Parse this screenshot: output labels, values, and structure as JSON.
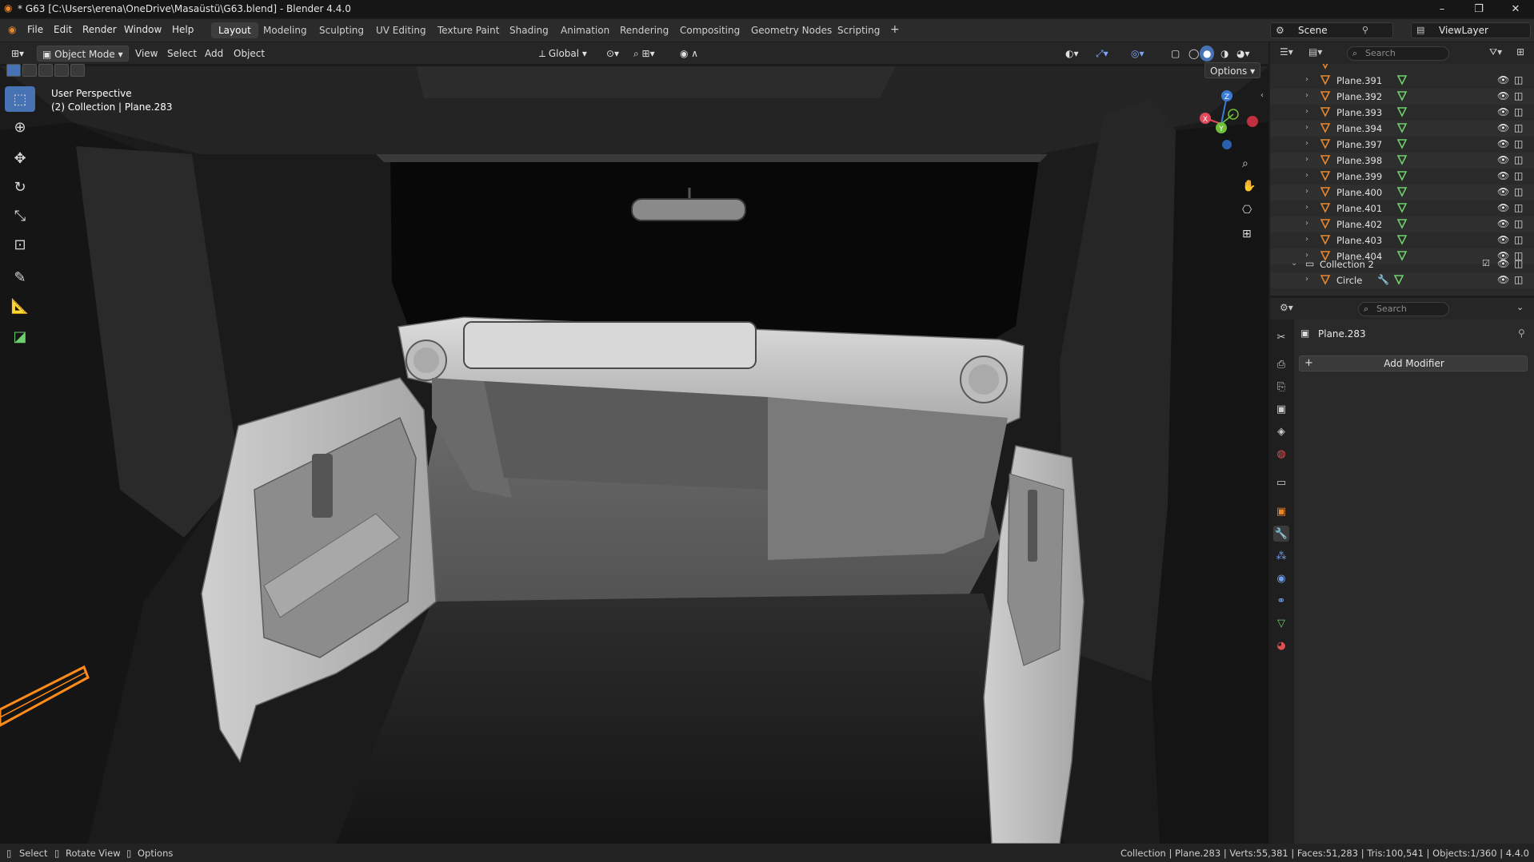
{
  "titlebar": {
    "title": "* G63 [C:\\Users\\erena\\OneDrive\\Masaüstü\\G63.blend] - Blender 4.4.0",
    "minimize": "–",
    "maximize": "❐",
    "close": "✕"
  },
  "menubar": {
    "menus": [
      "File",
      "Edit",
      "Render",
      "Window",
      "Help"
    ],
    "workspaces": [
      "Layout",
      "Modeling",
      "Sculpting",
      "UV Editing",
      "Texture Paint",
      "Shading",
      "Animation",
      "Rendering",
      "Compositing",
      "Geometry Nodes",
      "Scripting"
    ],
    "active_workspace": "Layout",
    "add_tab": "+",
    "scene_label": "Scene",
    "view_layer_label": "ViewLayer"
  },
  "viewport_header": {
    "mode": "Object Mode",
    "menus": [
      "View",
      "Select",
      "Add",
      "Object"
    ],
    "orientation": "Global",
    "options_label": "Options"
  },
  "viewport": {
    "perspective_label": "User Perspective",
    "collection_label": "(2) Collection | Plane.283",
    "gizmo": {
      "x": "X",
      "y": "Y",
      "z": "Z"
    }
  },
  "toolbar": {
    "tools": [
      "select-box",
      "cursor",
      "move",
      "rotate",
      "scale",
      "transform",
      "annotate",
      "measure",
      "add-cube"
    ]
  },
  "outliner": {
    "search_placeholder": "Search",
    "items": [
      {
        "name": "Plane.391"
      },
      {
        "name": "Plane.392"
      },
      {
        "name": "Plane.393"
      },
      {
        "name": "Plane.394"
      },
      {
        "name": "Plane.397"
      },
      {
        "name": "Plane.398"
      },
      {
        "name": "Plane.399"
      },
      {
        "name": "Plane.400"
      },
      {
        "name": "Plane.401"
      },
      {
        "name": "Plane.402"
      },
      {
        "name": "Plane.403"
      },
      {
        "name": "Plane.404"
      }
    ],
    "collection2": "Collection 2",
    "circle": "Circle"
  },
  "properties": {
    "search_placeholder": "Search",
    "object_name": "Plane.283",
    "add_modifier_label": "Add Modifier"
  },
  "statusbar": {
    "select": "Select",
    "rotate_view": "Rotate View",
    "options": "Options",
    "stats": "Collection | Plane.283 | Verts:55,381 | Faces:51,283 | Tris:100,541 | Objects:1/360 | 4.4.0"
  },
  "colors": {
    "accent_blue": "#4772b3",
    "mesh_orange": "#e8872a",
    "mesh_green": "#6fcf6f",
    "selection_orange": "#ff8c1a"
  }
}
